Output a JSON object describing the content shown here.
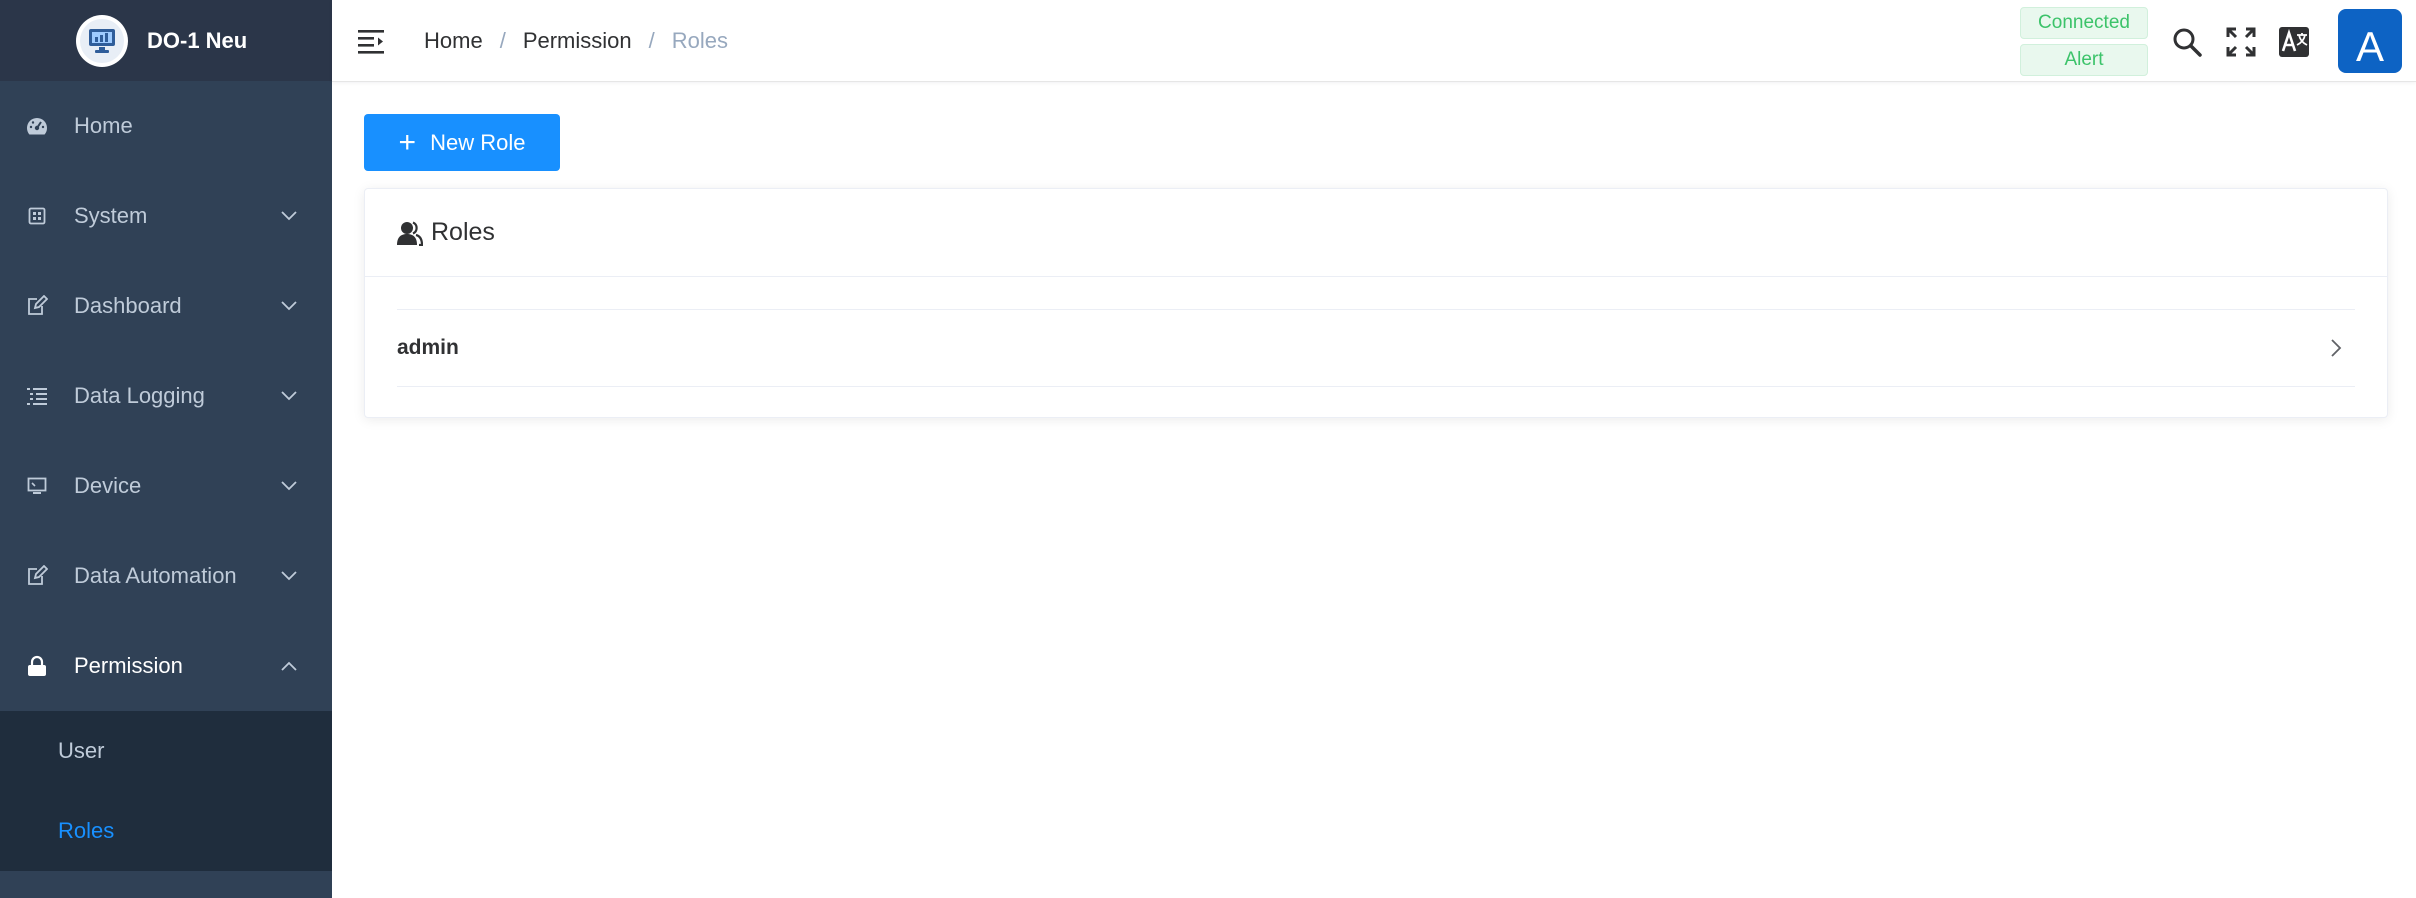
{
  "brand": {
    "title": "DO-1 Neu"
  },
  "sidebar": {
    "items": [
      {
        "label": "Home",
        "icon": "dashboard-gauge-icon"
      },
      {
        "label": "System",
        "icon": "system-chip-icon"
      },
      {
        "label": "Dashboard",
        "icon": "edit-icon"
      },
      {
        "label": "Data Logging",
        "icon": "list-icon"
      },
      {
        "label": "Device",
        "icon": "monitor-icon"
      },
      {
        "label": "Data Automation",
        "icon": "edit-icon"
      },
      {
        "label": "Permission",
        "icon": "lock-icon"
      }
    ],
    "permission_sub": [
      {
        "label": "User"
      },
      {
        "label": "Roles"
      }
    ]
  },
  "header": {
    "breadcrumb": [
      "Home",
      "Permission",
      "Roles"
    ],
    "status_connected": "Connected",
    "status_alert": "Alert",
    "avatar_letter": "A"
  },
  "main": {
    "new_button_label": "New Role",
    "card_title": "Roles",
    "roles": [
      {
        "name": "admin"
      }
    ]
  },
  "colors": {
    "sidebar_bg": "#304156",
    "accent": "#1890ff",
    "status_green": "#3cc36a",
    "avatar_bg": "#0d63c4"
  }
}
